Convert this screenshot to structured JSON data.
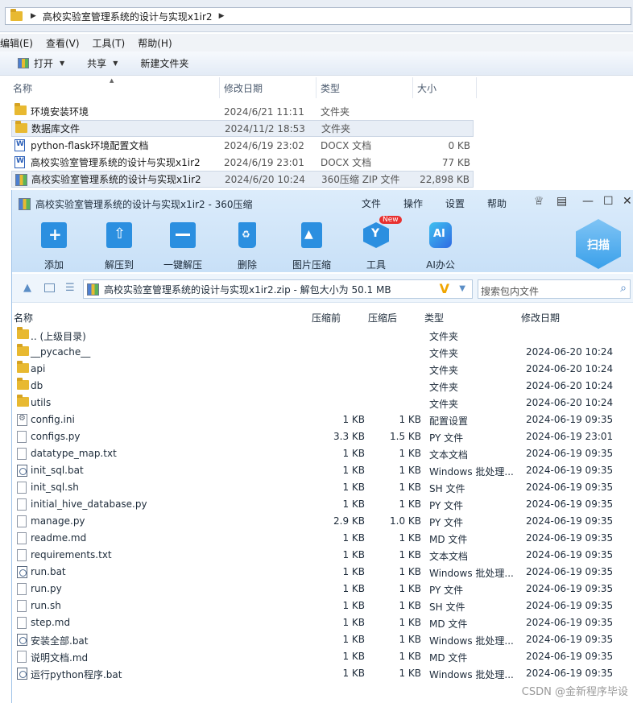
{
  "explorer": {
    "path": "高校实验室管理系统的设计与实现x1ir2",
    "menu": [
      "编辑(E)",
      "查看(V)",
      "工具(T)",
      "帮助(H)"
    ],
    "toolbar": {
      "open": "打开",
      "share": "共享",
      "new_folder": "新建文件夹"
    },
    "columns": {
      "name": "名称",
      "date": "修改日期",
      "type": "类型",
      "size": "大小"
    },
    "files": [
      {
        "name": "环境安装环境",
        "date": "2024/6/21 11:11",
        "type": "文件夹",
        "size": "",
        "icon": "folder-icon"
      },
      {
        "name": "数据库文件",
        "date": "2024/11/2 18:53",
        "type": "文件夹",
        "size": "",
        "icon": "folder-icon"
      },
      {
        "name": "python-flask环境配置文档",
        "date": "2024/6/19 23:02",
        "type": "DOCX 文档",
        "size": "0 KB",
        "icon": "docx-icon"
      },
      {
        "name": "高校实验室管理系统的设计与实现x1ir2",
        "date": "2024/6/19 23:01",
        "type": "DOCX 文档",
        "size": "77 KB",
        "icon": "docx-icon"
      },
      {
        "name": "高校实验室管理系统的设计与实现x1ir2",
        "date": "2024/6/20 10:24",
        "type": "360压缩 ZIP 文件",
        "size": "22,898 KB",
        "icon": "zip-icon"
      }
    ]
  },
  "zip": {
    "title": "高校实验室管理系统的设计与实现x1ir2 - 360压缩",
    "menu": {
      "file": "文件",
      "ops": "操作",
      "settings": "设置",
      "help": "帮助"
    },
    "tools": {
      "add": "添加",
      "extract_to": "解压到",
      "one_click": "一键解压",
      "delete": "删除",
      "image_compress": "图片压缩",
      "tools": "工具",
      "ai": "AI办公",
      "new_badge": "New",
      "ai_icon_text": "AI"
    },
    "scan": "扫描",
    "path": "高校实验室管理系统的设计与实现x1ir2.zip - 解包大小为 50.1 MB",
    "search_placeholder": "搜索包内文件",
    "columns": {
      "name": "名称",
      "before": "压缩前",
      "after": "压缩后",
      "type": "类型",
      "date": "修改日期"
    },
    "files": [
      {
        "name": ".. (上级目录)",
        "before": "",
        "after": "",
        "type": "文件夹",
        "date": "",
        "icon": "folder-icon"
      },
      {
        "name": "__pycache__",
        "before": "",
        "after": "",
        "type": "文件夹",
        "date": "2024-06-20 10:24",
        "icon": "folder-icon"
      },
      {
        "name": "api",
        "before": "",
        "after": "",
        "type": "文件夹",
        "date": "2024-06-20 10:24",
        "icon": "folder-icon"
      },
      {
        "name": "db",
        "before": "",
        "after": "",
        "type": "文件夹",
        "date": "2024-06-20 10:24",
        "icon": "folder-icon"
      },
      {
        "name": "utils",
        "before": "",
        "after": "",
        "type": "文件夹",
        "date": "2024-06-20 10:24",
        "icon": "folder-icon"
      },
      {
        "name": "config.ini",
        "before": "1 KB",
        "after": "1 KB",
        "type": "配置设置",
        "date": "2024-06-19 09:35",
        "icon": "config-icon"
      },
      {
        "name": "configs.py",
        "before": "3.3 KB",
        "after": "1.5 KB",
        "type": "PY 文件",
        "date": "2024-06-19 23:01",
        "icon": "file-icon"
      },
      {
        "name": "datatype_map.txt",
        "before": "1 KB",
        "after": "1 KB",
        "type": "文本文档",
        "date": "2024-06-19 09:35",
        "icon": "file-icon"
      },
      {
        "name": "init_sql.bat",
        "before": "1 KB",
        "after": "1 KB",
        "type": "Windows 批处理...",
        "date": "2024-06-19 09:35",
        "icon": "bat-icon"
      },
      {
        "name": "init_sql.sh",
        "before": "1 KB",
        "after": "1 KB",
        "type": "SH 文件",
        "date": "2024-06-19 09:35",
        "icon": "file-icon"
      },
      {
        "name": "initial_hive_database.py",
        "before": "1 KB",
        "after": "1 KB",
        "type": "PY 文件",
        "date": "2024-06-19 09:35",
        "icon": "file-icon"
      },
      {
        "name": "manage.py",
        "before": "2.9 KB",
        "after": "1.0 KB",
        "type": "PY 文件",
        "date": "2024-06-19 09:35",
        "icon": "file-icon"
      },
      {
        "name": "readme.md",
        "before": "1 KB",
        "after": "1 KB",
        "type": "MD 文件",
        "date": "2024-06-19 09:35",
        "icon": "file-icon"
      },
      {
        "name": "requirements.txt",
        "before": "1 KB",
        "after": "1 KB",
        "type": "文本文档",
        "date": "2024-06-19 09:35",
        "icon": "file-icon"
      },
      {
        "name": "run.bat",
        "before": "1 KB",
        "after": "1 KB",
        "type": "Windows 批处理...",
        "date": "2024-06-19 09:35",
        "icon": "bat-icon"
      },
      {
        "name": "run.py",
        "before": "1 KB",
        "after": "1 KB",
        "type": "PY 文件",
        "date": "2024-06-19 09:35",
        "icon": "file-icon"
      },
      {
        "name": "run.sh",
        "before": "1 KB",
        "after": "1 KB",
        "type": "SH 文件",
        "date": "2024-06-19 09:35",
        "icon": "file-icon"
      },
      {
        "name": "step.md",
        "before": "1 KB",
        "after": "1 KB",
        "type": "MD 文件",
        "date": "2024-06-19 09:35",
        "icon": "file-icon"
      },
      {
        "name": "安装全部.bat",
        "before": "1 KB",
        "after": "1 KB",
        "type": "Windows 批处理...",
        "date": "2024-06-19 09:35",
        "icon": "bat-icon"
      },
      {
        "name": "说明文档.md",
        "before": "1 KB",
        "after": "1 KB",
        "type": "MD 文件",
        "date": "2024-06-19 09:35",
        "icon": "file-icon"
      },
      {
        "name": "运行python程序.bat",
        "before": "1 KB",
        "after": "1 KB",
        "type": "Windows 批处理...",
        "date": "2024-06-19 09:35",
        "icon": "bat-icon"
      }
    ]
  },
  "watermark": "CSDN @金新程序毕设",
  "colors": {
    "accent": "#2b8fe0",
    "folder": "#e8b931",
    "header_bg": "#dcecfb"
  }
}
